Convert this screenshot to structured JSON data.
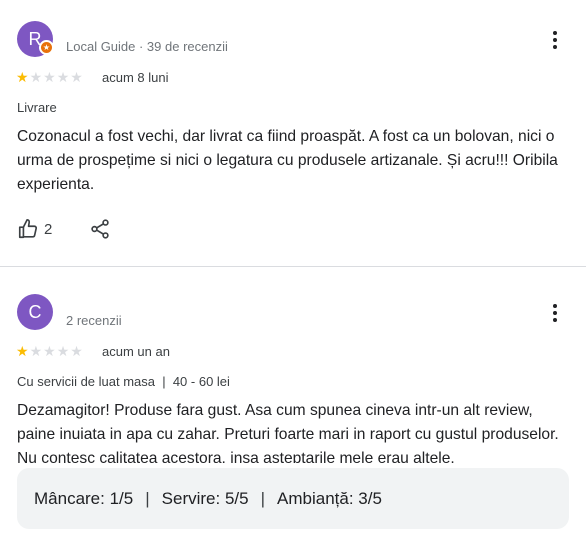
{
  "reviews": [
    {
      "avatar_letter": "R",
      "avatar_color": "#7e57c2",
      "local_guide": true,
      "meta": "Local Guide · 39 de recenzii",
      "rating": 1,
      "date": "acum 8 luni",
      "tag": "Livrare",
      "text": "Cozonacul a fost vechi, dar livrat ca fiind proaspăt. A fost ca un bolovan, nici o urma de prospețime si nici o legatura cu produsele artizanale. Și acru!!! Oribila experienta.",
      "likes": "2"
    },
    {
      "avatar_letter": "C",
      "avatar_color": "#7e57c2",
      "local_guide": false,
      "meta": "2 recenzii",
      "rating": 1,
      "date": "acum un an",
      "tag": "Cu servicii de luat masa  |  40 - 60 lei",
      "text": "Dezamagitor! Produse fara gust. Asa cum spunea cineva intr-un alt review, paine inuiata in apa cu zahar. Preturi foarte mari in raport cu gustul produselor. Nu contesc calitatea acestora, insa asteptarile mele erau altele."
    }
  ],
  "sub_ratings": {
    "food": "Mâncare: 1/5",
    "service": "Servire: 5/5",
    "ambience": "Ambianță: 3/5",
    "separator": "|"
  },
  "colors": {
    "star_on": "#fbbc04",
    "star_off": "#dadce0",
    "badge": "#e8710a"
  },
  "icons": [
    "more-vert-icon",
    "thumb-up-icon",
    "share-icon",
    "local-guide-star-icon",
    "star-icon"
  ]
}
